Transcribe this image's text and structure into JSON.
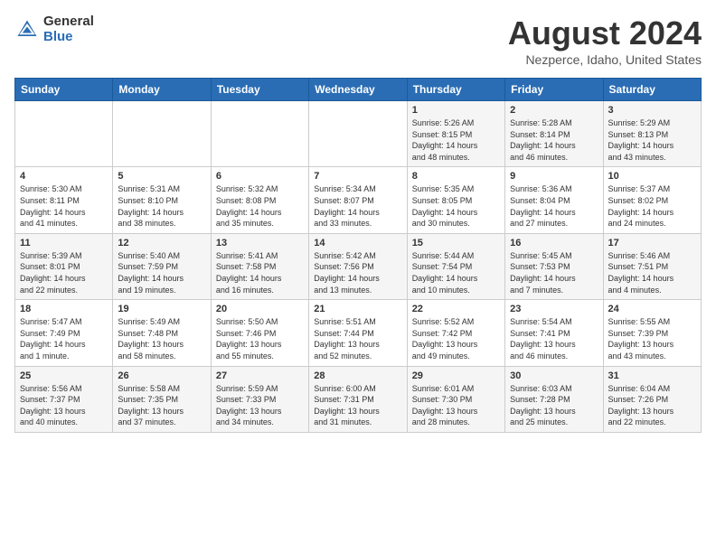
{
  "header": {
    "logo_general": "General",
    "logo_blue": "Blue",
    "title": "August 2024",
    "subtitle": "Nezperce, Idaho, United States"
  },
  "weekdays": [
    "Sunday",
    "Monday",
    "Tuesday",
    "Wednesday",
    "Thursday",
    "Friday",
    "Saturday"
  ],
  "weeks": [
    [
      {
        "day": "",
        "info": ""
      },
      {
        "day": "",
        "info": ""
      },
      {
        "day": "",
        "info": ""
      },
      {
        "day": "",
        "info": ""
      },
      {
        "day": "1",
        "info": "Sunrise: 5:26 AM\nSunset: 8:15 PM\nDaylight: 14 hours\nand 48 minutes."
      },
      {
        "day": "2",
        "info": "Sunrise: 5:28 AM\nSunset: 8:14 PM\nDaylight: 14 hours\nand 46 minutes."
      },
      {
        "day": "3",
        "info": "Sunrise: 5:29 AM\nSunset: 8:13 PM\nDaylight: 14 hours\nand 43 minutes."
      }
    ],
    [
      {
        "day": "4",
        "info": "Sunrise: 5:30 AM\nSunset: 8:11 PM\nDaylight: 14 hours\nand 41 minutes."
      },
      {
        "day": "5",
        "info": "Sunrise: 5:31 AM\nSunset: 8:10 PM\nDaylight: 14 hours\nand 38 minutes."
      },
      {
        "day": "6",
        "info": "Sunrise: 5:32 AM\nSunset: 8:08 PM\nDaylight: 14 hours\nand 35 minutes."
      },
      {
        "day": "7",
        "info": "Sunrise: 5:34 AM\nSunset: 8:07 PM\nDaylight: 14 hours\nand 33 minutes."
      },
      {
        "day": "8",
        "info": "Sunrise: 5:35 AM\nSunset: 8:05 PM\nDaylight: 14 hours\nand 30 minutes."
      },
      {
        "day": "9",
        "info": "Sunrise: 5:36 AM\nSunset: 8:04 PM\nDaylight: 14 hours\nand 27 minutes."
      },
      {
        "day": "10",
        "info": "Sunrise: 5:37 AM\nSunset: 8:02 PM\nDaylight: 14 hours\nand 24 minutes."
      }
    ],
    [
      {
        "day": "11",
        "info": "Sunrise: 5:39 AM\nSunset: 8:01 PM\nDaylight: 14 hours\nand 22 minutes."
      },
      {
        "day": "12",
        "info": "Sunrise: 5:40 AM\nSunset: 7:59 PM\nDaylight: 14 hours\nand 19 minutes."
      },
      {
        "day": "13",
        "info": "Sunrise: 5:41 AM\nSunset: 7:58 PM\nDaylight: 14 hours\nand 16 minutes."
      },
      {
        "day": "14",
        "info": "Sunrise: 5:42 AM\nSunset: 7:56 PM\nDaylight: 14 hours\nand 13 minutes."
      },
      {
        "day": "15",
        "info": "Sunrise: 5:44 AM\nSunset: 7:54 PM\nDaylight: 14 hours\nand 10 minutes."
      },
      {
        "day": "16",
        "info": "Sunrise: 5:45 AM\nSunset: 7:53 PM\nDaylight: 14 hours\nand 7 minutes."
      },
      {
        "day": "17",
        "info": "Sunrise: 5:46 AM\nSunset: 7:51 PM\nDaylight: 14 hours\nand 4 minutes."
      }
    ],
    [
      {
        "day": "18",
        "info": "Sunrise: 5:47 AM\nSunset: 7:49 PM\nDaylight: 14 hours\nand 1 minute."
      },
      {
        "day": "19",
        "info": "Sunrise: 5:49 AM\nSunset: 7:48 PM\nDaylight: 13 hours\nand 58 minutes."
      },
      {
        "day": "20",
        "info": "Sunrise: 5:50 AM\nSunset: 7:46 PM\nDaylight: 13 hours\nand 55 minutes."
      },
      {
        "day": "21",
        "info": "Sunrise: 5:51 AM\nSunset: 7:44 PM\nDaylight: 13 hours\nand 52 minutes."
      },
      {
        "day": "22",
        "info": "Sunrise: 5:52 AM\nSunset: 7:42 PM\nDaylight: 13 hours\nand 49 minutes."
      },
      {
        "day": "23",
        "info": "Sunrise: 5:54 AM\nSunset: 7:41 PM\nDaylight: 13 hours\nand 46 minutes."
      },
      {
        "day": "24",
        "info": "Sunrise: 5:55 AM\nSunset: 7:39 PM\nDaylight: 13 hours\nand 43 minutes."
      }
    ],
    [
      {
        "day": "25",
        "info": "Sunrise: 5:56 AM\nSunset: 7:37 PM\nDaylight: 13 hours\nand 40 minutes."
      },
      {
        "day": "26",
        "info": "Sunrise: 5:58 AM\nSunset: 7:35 PM\nDaylight: 13 hours\nand 37 minutes."
      },
      {
        "day": "27",
        "info": "Sunrise: 5:59 AM\nSunset: 7:33 PM\nDaylight: 13 hours\nand 34 minutes."
      },
      {
        "day": "28",
        "info": "Sunrise: 6:00 AM\nSunset: 7:31 PM\nDaylight: 13 hours\nand 31 minutes."
      },
      {
        "day": "29",
        "info": "Sunrise: 6:01 AM\nSunset: 7:30 PM\nDaylight: 13 hours\nand 28 minutes."
      },
      {
        "day": "30",
        "info": "Sunrise: 6:03 AM\nSunset: 7:28 PM\nDaylight: 13 hours\nand 25 minutes."
      },
      {
        "day": "31",
        "info": "Sunrise: 6:04 AM\nSunset: 7:26 PM\nDaylight: 13 hours\nand 22 minutes."
      }
    ]
  ]
}
